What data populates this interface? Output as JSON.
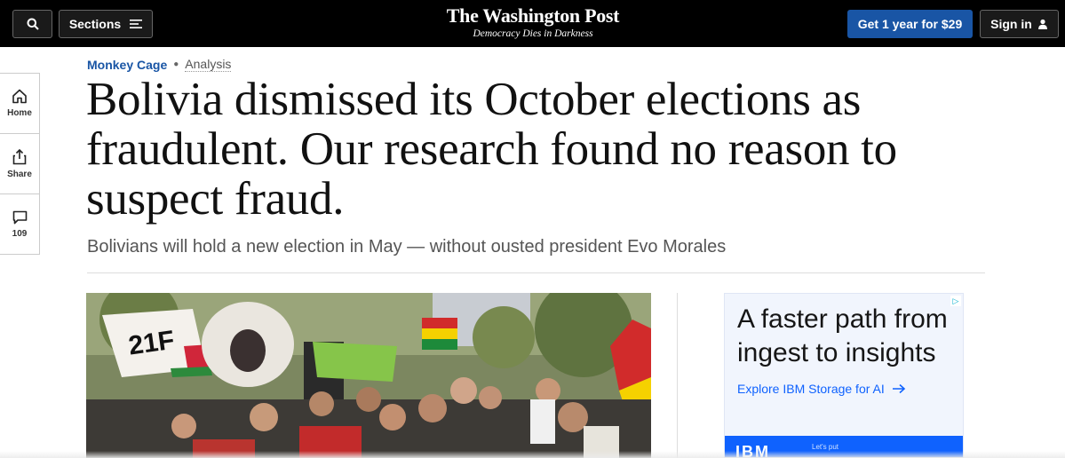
{
  "topbar": {
    "sections_label": "Sections",
    "logo": "The Washington Post",
    "tagline": "Democracy Dies in Darkness",
    "subscribe_label": "Get 1 year for $29",
    "signin_label": "Sign in"
  },
  "rail": {
    "home_label": "Home",
    "share_label": "Share",
    "comments_count": "109"
  },
  "article": {
    "section": "Monkey Cage",
    "label": "Analysis",
    "headline": "Bolivia dismissed its October elections as fraudulent. Our research found no reason to suspect fraud.",
    "subheadline": "Bolivians will hold a new election in May — without ousted president Evo Morales",
    "photo_sign_text": "21F"
  },
  "ad": {
    "headline": "A faster path from ingest to insights",
    "cta": "Explore IBM Storage for AI",
    "brand": "IBM",
    "small_text": "Let's put"
  },
  "colors": {
    "accent_blue": "#1955a5",
    "topbar_bg": "#000000",
    "ad_blue": "#0f62fe"
  }
}
